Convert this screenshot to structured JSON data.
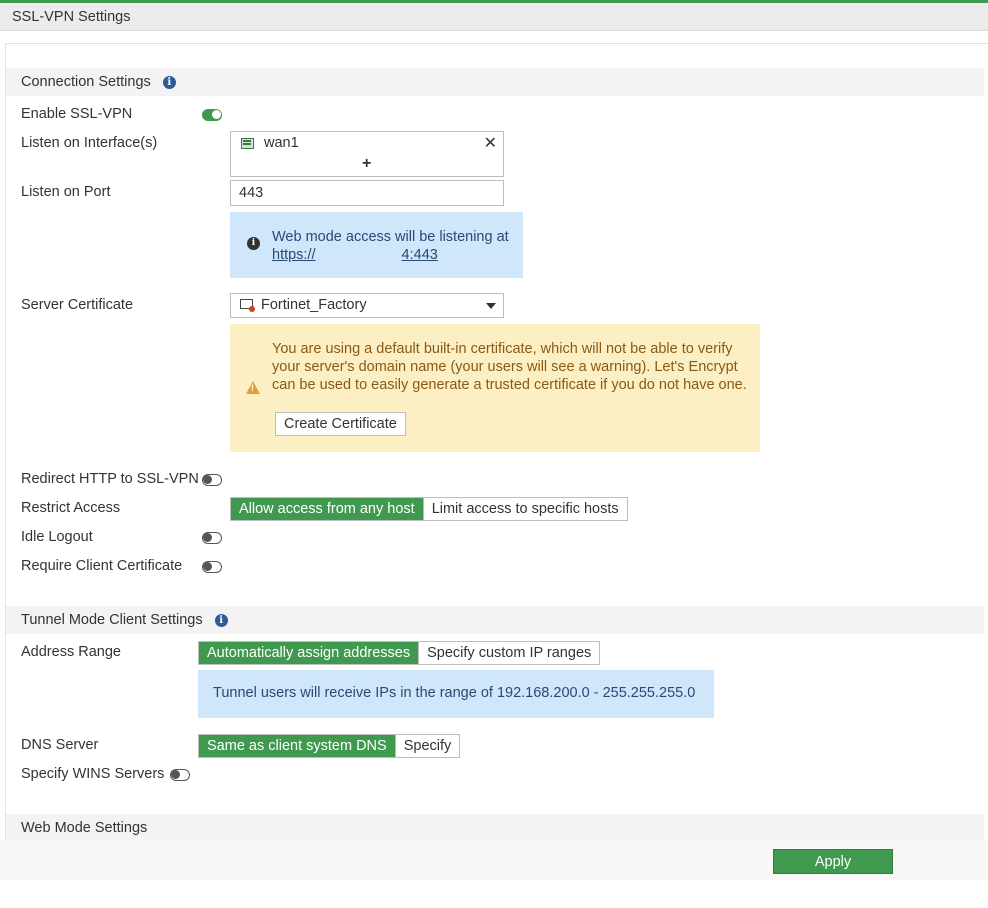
{
  "window": {
    "title": "SSL-VPN Settings"
  },
  "connection": {
    "header": "Connection Settings",
    "enable_label": "Enable SSL-VPN",
    "listen_interfaces_label": "Listen on Interface(s)",
    "interface_name": "wan1",
    "interface_add": "+",
    "listen_port_label": "Listen on Port",
    "listen_port_value": "443",
    "web_mode_info": "Web mode access will be listening at",
    "web_mode_link_start": "https://",
    "web_mode_link_end": "4:443",
    "server_cert_label": "Server Certificate",
    "server_cert_value": "Fortinet_Factory",
    "cert_warning": "You are using a default built-in certificate, which will not be able to verify your server's domain name (your users will see a warning). Let's Encrypt can be used to easily generate a trusted certificate if you do not have one.",
    "create_cert_button": "Create Certificate",
    "redirect_label": "Redirect HTTP to SSL-VPN",
    "restrict_label": "Restrict Access",
    "restrict_options": [
      "Allow access from any host",
      "Limit access to specific hosts"
    ],
    "idle_logout_label": "Idle Logout",
    "require_client_cert_label": "Require Client Certificate",
    "enable_state": "on",
    "redirect_state": "off",
    "idle_logout_state": "off",
    "require_client_cert_state": "off"
  },
  "tunnel": {
    "header": "Tunnel Mode Client Settings",
    "address_range_label": "Address Range",
    "address_range_options": [
      "Automatically assign addresses",
      "Specify custom IP ranges"
    ],
    "range_info": "Tunnel users will receive IPs in the range of 192.168.200.0 - 255.255.255.0",
    "dns_label": "DNS Server",
    "dns_options": [
      "Same as client system DNS",
      "Specify"
    ],
    "wins_label": "Specify WINS Servers",
    "wins_state": "off"
  },
  "web_mode": {
    "header": "Web Mode Settings"
  },
  "footer": {
    "apply_label": "Apply"
  },
  "colors": {
    "accent": "#3f9a4f",
    "info_bg": "#cfe6fb",
    "warn_bg": "#fcefc4"
  },
  "icons": {
    "info": "info-icon",
    "interface": "network-port-icon",
    "remove": "close-icon",
    "certificate": "certificate-icon",
    "warning": "warning-icon",
    "dropdown": "chevron-down-icon"
  }
}
